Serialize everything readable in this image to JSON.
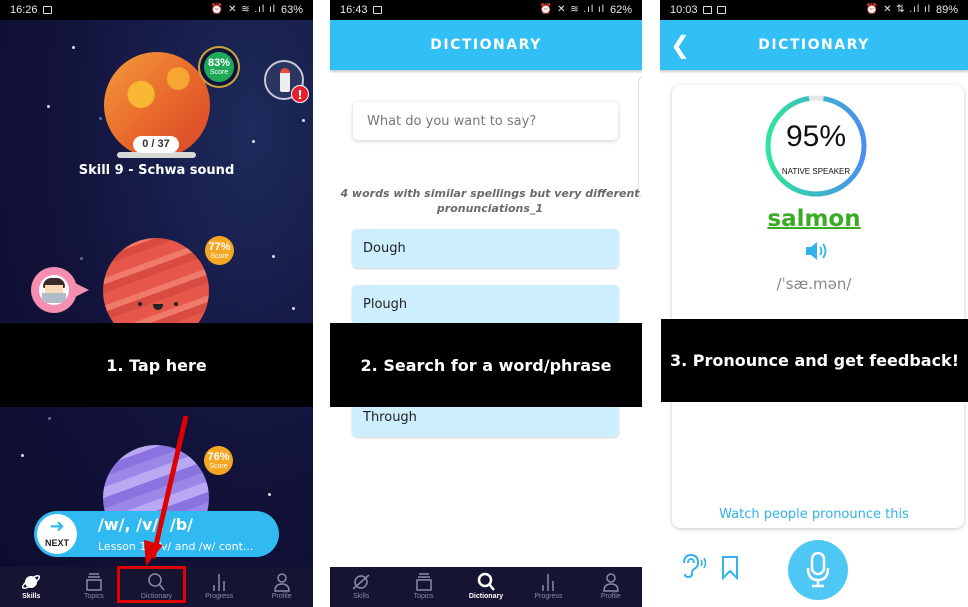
{
  "panel1": {
    "status": {
      "time": "16:26",
      "system_icons": "⏰ ✕ ≋ .ıl ıl",
      "battery": "63%"
    },
    "skills": [
      {
        "title": "Skill 9 -   Schwa sound",
        "progress_text": "0 / 37",
        "score_pct": "83%",
        "score_label": "Score"
      },
      {
        "score_pct": "77%",
        "score_label": "Score"
      },
      {
        "score_pct": "76%",
        "score_label": "Score"
      }
    ],
    "alert_badge": "!",
    "next_card": {
      "button_label": "NEXT",
      "title": "/w/, /v/, /b/",
      "subtitle": "Lesson 1 - /v/ and /w/ cont..."
    },
    "instruction": "1. Tap here",
    "nav": [
      {
        "label": "Skills",
        "icon": "planet-icon",
        "active": true
      },
      {
        "label": "Topics",
        "icon": "layers-icon",
        "active": false
      },
      {
        "label": "Dictionary",
        "icon": "search-icon",
        "active": false
      },
      {
        "label": "Progress",
        "icon": "bar-chart-icon",
        "active": false
      },
      {
        "label": "Profile",
        "icon": "person-icon",
        "active": false
      }
    ]
  },
  "panel2": {
    "status": {
      "time": "16:43",
      "system_icons": "⏰ ✕ ≋ .ıl ıl",
      "battery": "62%"
    },
    "header_title": "DICTIONARY",
    "search_placeholder": "What do you want to say?",
    "list_caption": "4 words with similar spellings but very different pronunciations_1",
    "words": [
      "Dough",
      "Plough",
      "Through"
    ],
    "instruction": "2. Search for a word/phrase",
    "nav": [
      {
        "label": "Skills",
        "icon": "planet-icon",
        "active": false
      },
      {
        "label": "Topics",
        "icon": "layers-icon",
        "active": false
      },
      {
        "label": "Dictionary",
        "icon": "search-icon",
        "active": true
      },
      {
        "label": "Progress",
        "icon": "bar-chart-icon",
        "active": false
      },
      {
        "label": "Profile",
        "icon": "person-icon",
        "active": false
      }
    ]
  },
  "panel3": {
    "status": {
      "time": "10:03",
      "system_icons": "⏰ ✕ ⇅ .ıl ıl",
      "battery": "89%"
    },
    "header_title": "DICTIONARY",
    "score": {
      "value": 95,
      "text": "95%",
      "label": "NATIVE SPEAKER"
    },
    "word": "salmon",
    "ipa": "/ˈsæ.mən/",
    "watch_link": "Watch people pronounce this",
    "instruction": "3. Pronounce and get feedback!"
  },
  "colors": {
    "brand_blue": "#31bff6",
    "word_green": "#3bab26",
    "highlight_red": "#e10000",
    "nav_bg": "#151433"
  }
}
